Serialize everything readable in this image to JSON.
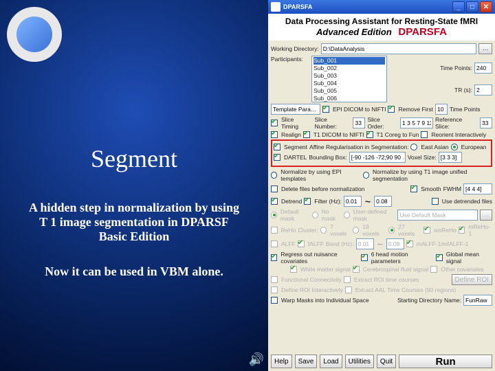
{
  "presentation": {
    "heading": "Segment",
    "para1": "A hidden step in normalization by using T 1 image segmentation in DPARSF Basic Edition",
    "para2": "Now it can be used in VBM alone."
  },
  "window": {
    "title": "DPARSFA",
    "header_line1": "Data Processing Assistant for Resting-State fMRI",
    "header_line2_left": "Advanced Edition",
    "header_line2_acr": "DPARSFA"
  },
  "workdir": {
    "label": "Working Directory:",
    "value": "D:\\DataAnalysis"
  },
  "participants": {
    "label": "Participants:",
    "items": [
      "Sub_001",
      "Sub_002",
      "Sub_003",
      "Sub_004",
      "Sub_005",
      "Sub_006"
    ],
    "time_points_label": "Time Points:",
    "time_points": "240",
    "tr_label": "TR (s):",
    "tr": "2"
  },
  "row_para": {
    "template": "Template Para…",
    "epi2nifti": "EPI DICOM to NIFTI",
    "remove_first": "Remove First",
    "remove_first_val": "10",
    "remove_first_suffix": "Time Points"
  },
  "row_slice": {
    "slice_timing": "Slice Timing",
    "slice_number": "Slice Number:",
    "slice_number_val": "33",
    "slice_order": "Slice Order:",
    "slice_order_val": "1 3 5 7 9 11",
    "ref_slice": "Reference Slice:",
    "ref_slice_val": "33"
  },
  "row_realign": {
    "realign": "Realign",
    "t1dicom": "T1 DICOM to NIFTI",
    "coreg": "T1 Coreg to Fun",
    "reorient": "Reorient Interactively"
  },
  "row_segment": {
    "segment": "Segment",
    "affine": "Affine Regularisation in Segmentation:",
    "east_asian": "East Asian",
    "european": "European"
  },
  "row_dartel": {
    "dartel": "DARTEL",
    "bounding": "Bounding Box:",
    "bounding_val": "[-90 -126 -72;90 90 …",
    "voxel_size": "Voxel Size:",
    "voxel_size_val": "[3 3 3]"
  },
  "row_norm": {
    "epi": "Normalize by using EPI templates",
    "t1uni": "Normalize by using T1 image unified segmentation"
  },
  "row_del_smooth": {
    "delete": "Delete files before normalization",
    "smooth": "Smooth",
    "fwhm": "FWHM",
    "fwhm_val": "[4 4 4]"
  },
  "row_detrend": {
    "detrend": "Detrend",
    "filter": "Filter (Hz):",
    "lo": "0.01",
    "hi": "0.08",
    "use_detrended": "Use detrended files"
  },
  "row_mask": {
    "default": "Default mask",
    "nomask": "No mask",
    "userdef": "User-defined mask",
    "path": "Use Default Mask"
  },
  "row_reho": {
    "reho": "ReHo",
    "cluster": "Cluster:",
    "c7": "7 voxels",
    "c19": "19 voxels",
    "c27": "27 voxels",
    "sm": "smReHo",
    "mreho": "mReHo-1"
  },
  "row_alff": {
    "alff": "ALFF",
    "falff": "fALFF",
    "band": "Band (Hz):",
    "lo": "0.01",
    "hi": "0.08",
    "malff": "mALFF-1/mfALFF-1"
  },
  "row_regress": {
    "regress": "Regress out nuisance covariates",
    "headmot": "6 head motion parameters",
    "global": "Global mean signal"
  },
  "row_regress2": {
    "wm": "White matter signal",
    "csf": "Cerebrospinal fluid signal",
    "other": "Other covariates"
  },
  "row_fc": {
    "fc": "Functional Connectivity",
    "extract": "Extract ROI time courses",
    "define": "Define ROI"
  },
  "row_roi": {
    "interactive": "Define ROI Interactively",
    "aal": "Extract AAL Time Courses (90 regions)"
  },
  "row_warp": {
    "warp": "Warp Masks into Individual Space",
    "startdir_lbl": "Starting Directory Name:",
    "startdir": "FunRaw"
  },
  "buttons": {
    "help": "Help",
    "save": "Save",
    "load": "Load",
    "util": "Utilities",
    "quit": "Quit",
    "run": "Run"
  }
}
